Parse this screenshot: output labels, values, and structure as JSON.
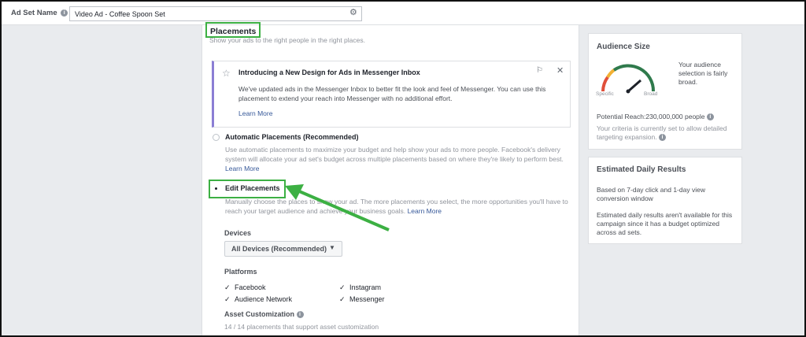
{
  "topbar": {
    "label": "Ad Set Name",
    "info_glyph": "i",
    "name_value": "Video Ad - Coffee Spoon Set",
    "settings_icon": "gear-icon"
  },
  "placements": {
    "title": "Placements",
    "subtitle": "Show your ads to the right people in the right places.",
    "notice": {
      "title": "Introducing a New Design for Ads in Messenger Inbox",
      "body": "We've updated ads in the Messenger Inbox to better fit the look and feel of Messenger. You can use this placement to extend your reach into Messenger with no additional effort.",
      "link": "Learn More",
      "star_glyph": "☆",
      "flag_glyph": "⚐",
      "close_glyph": "✕"
    },
    "automatic": {
      "title": "Automatic Placements (Recommended)",
      "description": "Use automatic placements to maximize your budget and help show your ads to more people. Facebook's delivery system will allocate your ad set's budget across multiple placements based on where they're likely to perform best.",
      "link": "Learn More",
      "selected": false
    },
    "edit": {
      "title": "Edit Placements",
      "description": "Manually choose the places to show your ad. The more placements you select, the more opportunities you'll have to reach your target audience and achieve your business goals.",
      "link": "Learn More",
      "selected": true
    },
    "devices": {
      "label": "Devices",
      "selected": "All Devices (Recommended)",
      "caret_glyph": "▼"
    },
    "platforms": {
      "label": "Platforms",
      "check_glyph": "✓",
      "items": [
        {
          "label": "Facebook",
          "checked": true
        },
        {
          "label": "Instagram",
          "checked": true
        },
        {
          "label": "Audience Network",
          "checked": true
        },
        {
          "label": "Messenger",
          "checked": true
        }
      ]
    },
    "asset_customization": {
      "label": "Asset Customization",
      "count": "14 / 14 placements that support asset customization"
    }
  },
  "audience_size": {
    "title": "Audience Size",
    "description": "Your audience selection is fairly broad.",
    "gauge_left": "Specific",
    "gauge_right": "Broad",
    "potential_reach": "Potential Reach:230,000,000 people",
    "criteria": "Your criteria is currently set to allow detailed targeting expansion.",
    "colors": {
      "red": "#e04f3a",
      "yellow": "#f2b134",
      "green": "#2f7a4c"
    }
  },
  "daily_results": {
    "title": "Estimated Daily Results",
    "window": "Based on 7-day click and 1-day view conversion window",
    "note": "Estimated daily results aren't available for this campaign since it has a budget optimized across ad sets."
  },
  "colors": {
    "highlight": "#3cb043",
    "link": "#365899",
    "notice_accent": "#8b7ed4"
  }
}
